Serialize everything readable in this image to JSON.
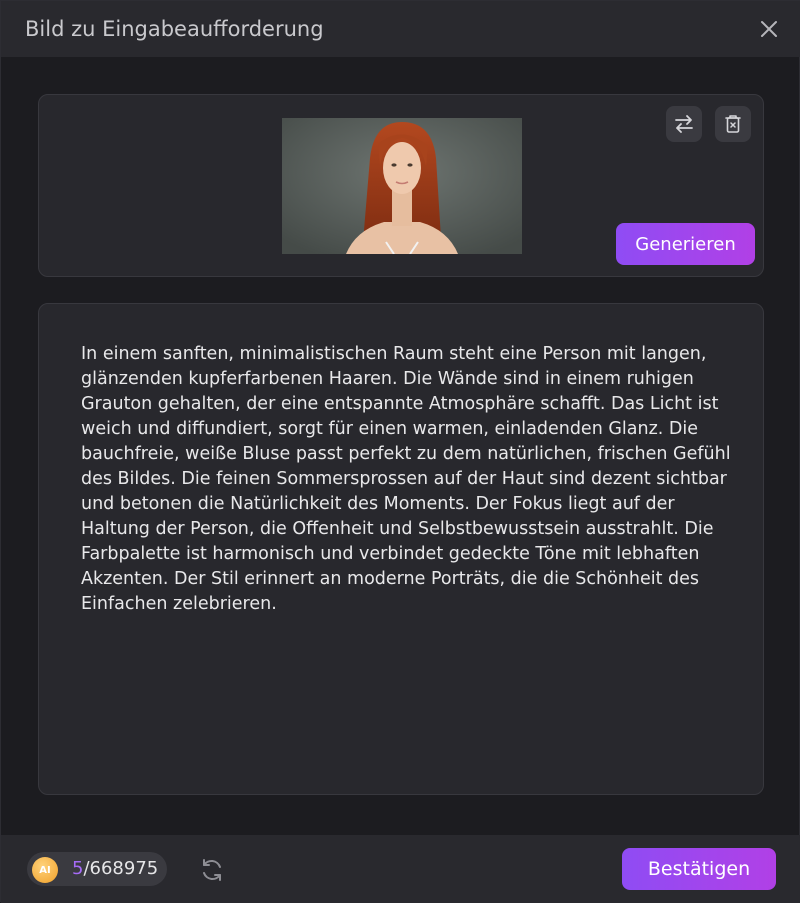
{
  "window": {
    "title": "Bild zu Eingabeaufforderung",
    "close_icon": "close-icon"
  },
  "image_panel": {
    "swap_icon": "swap-arrows-icon",
    "delete_icon": "delete-icon",
    "generate_label": "Generieren"
  },
  "prompt": {
    "text": "In einem sanften, minimalistischen Raum steht eine Person mit langen, glänzenden kupferfarbenen Haaren. Die Wände sind in einem ruhigen Grauton gehalten, der eine entspannte Atmosphäre schafft. Das Licht ist weich und diffundiert, sorgt für einen warmen, einladenden Glanz. Die bauchfreie, weiße Bluse passt perfekt zu dem natürlichen, frischen Gefühl des Bildes. Die feinen Sommersprossen auf der Haut sind dezent sichtbar und betonen die Natürlichkeit des Moments. Der Fokus liegt auf der Haltung der Person, die Offenheit und Selbstbewusstsein ausstrahlt. Die Farbpalette ist harmonisch und verbindet gedeckte Töne mit lebhaften Akzenten. Der Stil erinnert an moderne Porträts, die die Schönheit des Einfachen zelebrieren."
  },
  "footer": {
    "ai_badge": "AI",
    "credits_used": "5",
    "credits_separator": "/",
    "credits_total": "668975",
    "refresh_icon": "refresh-icon",
    "confirm_label": "Bestätigen"
  },
  "colors": {
    "accent_start": "#8f4cf4",
    "accent_end": "#b140e6",
    "credit_highlight": "#a56bf5",
    "background": "#1c1c20",
    "panel": "#28282d"
  }
}
